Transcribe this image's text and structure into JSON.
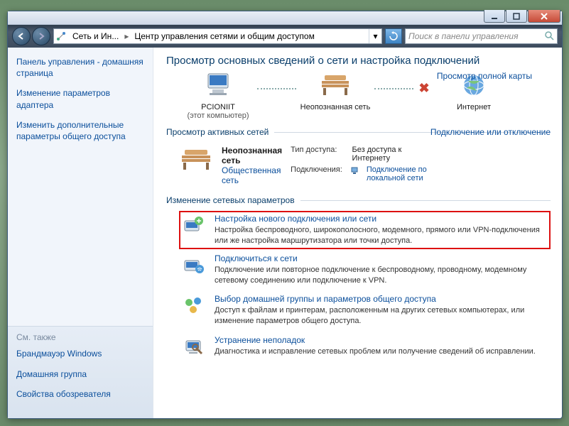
{
  "breadcrumb": {
    "seg1": "Сеть и Ин...",
    "seg2": "Центр управления сетями и общим доступом"
  },
  "search": {
    "placeholder": "Поиск в панели управления"
  },
  "sidebar": {
    "items": [
      "Панель управления - домашняя страница",
      "Изменение параметров адаптера",
      "Изменить дополнительные параметры общего доступа"
    ],
    "see_also_hdr": "См. также",
    "see_also": [
      "Брандмауэр Windows",
      "Домашняя группа",
      "Свойства обозревателя"
    ]
  },
  "main": {
    "title": "Просмотр основных сведений о сети и настройка подключений",
    "full_map_link": "Просмотр полной карты",
    "nodes": {
      "pc": {
        "label": "PCIONIIT",
        "sub": "(этот компьютер)"
      },
      "net": {
        "label": "Неопознанная сеть"
      },
      "inet": {
        "label": "Интернет"
      }
    },
    "active_hdr": "Просмотр активных сетей",
    "connect_link": "Подключение или отключение",
    "active": {
      "name": "Неопознанная сеть",
      "type": "Общественная сеть",
      "access_k": "Тип доступа:",
      "access_v": "Без доступа к Интернету",
      "conn_k": "Подключения:",
      "conn_v": "Подключение по локальной сети"
    },
    "change_hdr": "Изменение сетевых параметров",
    "tasks": [
      {
        "title": "Настройка нового подключения или сети",
        "desc": "Настройка беспроводного, широкополосного, модемного, прямого или VPN-подключения или же настройка маршрутизатора или точки доступа."
      },
      {
        "title": "Подключиться к сети",
        "desc": "Подключение или повторное подключение к беспроводному, проводному, модемному сетевому соединению или подключение к VPN."
      },
      {
        "title": "Выбор домашней группы и параметров общего доступа",
        "desc": "Доступ к файлам и принтерам, расположенным на других сетевых компьютерах, или изменение параметров общего доступа."
      },
      {
        "title": "Устранение неполадок",
        "desc": "Диагностика и исправление сетевых проблем или получение сведений об исправлении."
      }
    ]
  }
}
